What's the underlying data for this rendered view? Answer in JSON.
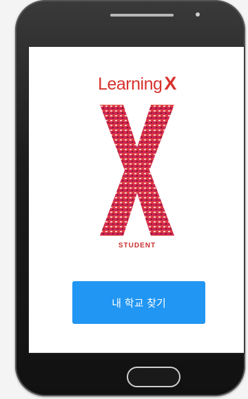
{
  "app": {
    "title_word": "Learning",
    "title_mark": "X",
    "subtitle": "STUDENT"
  },
  "actions": {
    "find_school_label": "내 학교 찾기"
  },
  "icons": {
    "logo": "x-logo-icon",
    "speaker": "speaker-icon",
    "camera": "camera-icon",
    "home": "home-button-icon"
  },
  "colors": {
    "brand_red": "#d8322e",
    "button_blue": "#2196f3",
    "phone_frame": "#1c1c1c"
  }
}
